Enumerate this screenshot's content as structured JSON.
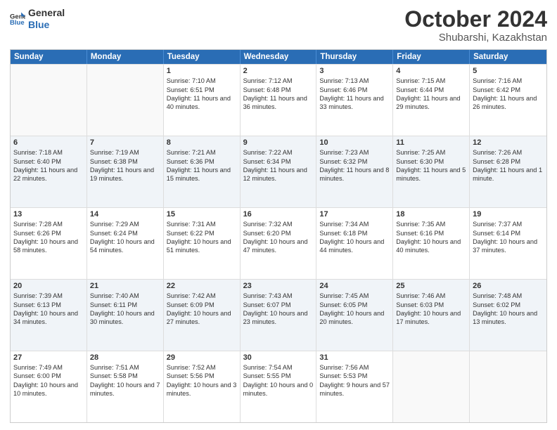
{
  "logo": {
    "line1": "General",
    "line2": "Blue"
  },
  "title": "October 2024",
  "subtitle": "Shubarshi, Kazakhstan",
  "header_days": [
    "Sunday",
    "Monday",
    "Tuesday",
    "Wednesday",
    "Thursday",
    "Friday",
    "Saturday"
  ],
  "weeks": [
    [
      {
        "day": "",
        "sunrise": "",
        "sunset": "",
        "daylight": ""
      },
      {
        "day": "",
        "sunrise": "",
        "sunset": "",
        "daylight": ""
      },
      {
        "day": "1",
        "sunrise": "Sunrise: 7:10 AM",
        "sunset": "Sunset: 6:51 PM",
        "daylight": "Daylight: 11 hours and 40 minutes."
      },
      {
        "day": "2",
        "sunrise": "Sunrise: 7:12 AM",
        "sunset": "Sunset: 6:48 PM",
        "daylight": "Daylight: 11 hours and 36 minutes."
      },
      {
        "day": "3",
        "sunrise": "Sunrise: 7:13 AM",
        "sunset": "Sunset: 6:46 PM",
        "daylight": "Daylight: 11 hours and 33 minutes."
      },
      {
        "day": "4",
        "sunrise": "Sunrise: 7:15 AM",
        "sunset": "Sunset: 6:44 PM",
        "daylight": "Daylight: 11 hours and 29 minutes."
      },
      {
        "day": "5",
        "sunrise": "Sunrise: 7:16 AM",
        "sunset": "Sunset: 6:42 PM",
        "daylight": "Daylight: 11 hours and 26 minutes."
      }
    ],
    [
      {
        "day": "6",
        "sunrise": "Sunrise: 7:18 AM",
        "sunset": "Sunset: 6:40 PM",
        "daylight": "Daylight: 11 hours and 22 minutes."
      },
      {
        "day": "7",
        "sunrise": "Sunrise: 7:19 AM",
        "sunset": "Sunset: 6:38 PM",
        "daylight": "Daylight: 11 hours and 19 minutes."
      },
      {
        "day": "8",
        "sunrise": "Sunrise: 7:21 AM",
        "sunset": "Sunset: 6:36 PM",
        "daylight": "Daylight: 11 hours and 15 minutes."
      },
      {
        "day": "9",
        "sunrise": "Sunrise: 7:22 AM",
        "sunset": "Sunset: 6:34 PM",
        "daylight": "Daylight: 11 hours and 12 minutes."
      },
      {
        "day": "10",
        "sunrise": "Sunrise: 7:23 AM",
        "sunset": "Sunset: 6:32 PM",
        "daylight": "Daylight: 11 hours and 8 minutes."
      },
      {
        "day": "11",
        "sunrise": "Sunrise: 7:25 AM",
        "sunset": "Sunset: 6:30 PM",
        "daylight": "Daylight: 11 hours and 5 minutes."
      },
      {
        "day": "12",
        "sunrise": "Sunrise: 7:26 AM",
        "sunset": "Sunset: 6:28 PM",
        "daylight": "Daylight: 11 hours and 1 minute."
      }
    ],
    [
      {
        "day": "13",
        "sunrise": "Sunrise: 7:28 AM",
        "sunset": "Sunset: 6:26 PM",
        "daylight": "Daylight: 10 hours and 58 minutes."
      },
      {
        "day": "14",
        "sunrise": "Sunrise: 7:29 AM",
        "sunset": "Sunset: 6:24 PM",
        "daylight": "Daylight: 10 hours and 54 minutes."
      },
      {
        "day": "15",
        "sunrise": "Sunrise: 7:31 AM",
        "sunset": "Sunset: 6:22 PM",
        "daylight": "Daylight: 10 hours and 51 minutes."
      },
      {
        "day": "16",
        "sunrise": "Sunrise: 7:32 AM",
        "sunset": "Sunset: 6:20 PM",
        "daylight": "Daylight: 10 hours and 47 minutes."
      },
      {
        "day": "17",
        "sunrise": "Sunrise: 7:34 AM",
        "sunset": "Sunset: 6:18 PM",
        "daylight": "Daylight: 10 hours and 44 minutes."
      },
      {
        "day": "18",
        "sunrise": "Sunrise: 7:35 AM",
        "sunset": "Sunset: 6:16 PM",
        "daylight": "Daylight: 10 hours and 40 minutes."
      },
      {
        "day": "19",
        "sunrise": "Sunrise: 7:37 AM",
        "sunset": "Sunset: 6:14 PM",
        "daylight": "Daylight: 10 hours and 37 minutes."
      }
    ],
    [
      {
        "day": "20",
        "sunrise": "Sunrise: 7:39 AM",
        "sunset": "Sunset: 6:13 PM",
        "daylight": "Daylight: 10 hours and 34 minutes."
      },
      {
        "day": "21",
        "sunrise": "Sunrise: 7:40 AM",
        "sunset": "Sunset: 6:11 PM",
        "daylight": "Daylight: 10 hours and 30 minutes."
      },
      {
        "day": "22",
        "sunrise": "Sunrise: 7:42 AM",
        "sunset": "Sunset: 6:09 PM",
        "daylight": "Daylight: 10 hours and 27 minutes."
      },
      {
        "day": "23",
        "sunrise": "Sunrise: 7:43 AM",
        "sunset": "Sunset: 6:07 PM",
        "daylight": "Daylight: 10 hours and 23 minutes."
      },
      {
        "day": "24",
        "sunrise": "Sunrise: 7:45 AM",
        "sunset": "Sunset: 6:05 PM",
        "daylight": "Daylight: 10 hours and 20 minutes."
      },
      {
        "day": "25",
        "sunrise": "Sunrise: 7:46 AM",
        "sunset": "Sunset: 6:03 PM",
        "daylight": "Daylight: 10 hours and 17 minutes."
      },
      {
        "day": "26",
        "sunrise": "Sunrise: 7:48 AM",
        "sunset": "Sunset: 6:02 PM",
        "daylight": "Daylight: 10 hours and 13 minutes."
      }
    ],
    [
      {
        "day": "27",
        "sunrise": "Sunrise: 7:49 AM",
        "sunset": "Sunset: 6:00 PM",
        "daylight": "Daylight: 10 hours and 10 minutes."
      },
      {
        "day": "28",
        "sunrise": "Sunrise: 7:51 AM",
        "sunset": "Sunset: 5:58 PM",
        "daylight": "Daylight: 10 hours and 7 minutes."
      },
      {
        "day": "29",
        "sunrise": "Sunrise: 7:52 AM",
        "sunset": "Sunset: 5:56 PM",
        "daylight": "Daylight: 10 hours and 3 minutes."
      },
      {
        "day": "30",
        "sunrise": "Sunrise: 7:54 AM",
        "sunset": "Sunset: 5:55 PM",
        "daylight": "Daylight: 10 hours and 0 minutes."
      },
      {
        "day": "31",
        "sunrise": "Sunrise: 7:56 AM",
        "sunset": "Sunset: 5:53 PM",
        "daylight": "Daylight: 9 hours and 57 minutes."
      },
      {
        "day": "",
        "sunrise": "",
        "sunset": "",
        "daylight": ""
      },
      {
        "day": "",
        "sunrise": "",
        "sunset": "",
        "daylight": ""
      }
    ]
  ]
}
